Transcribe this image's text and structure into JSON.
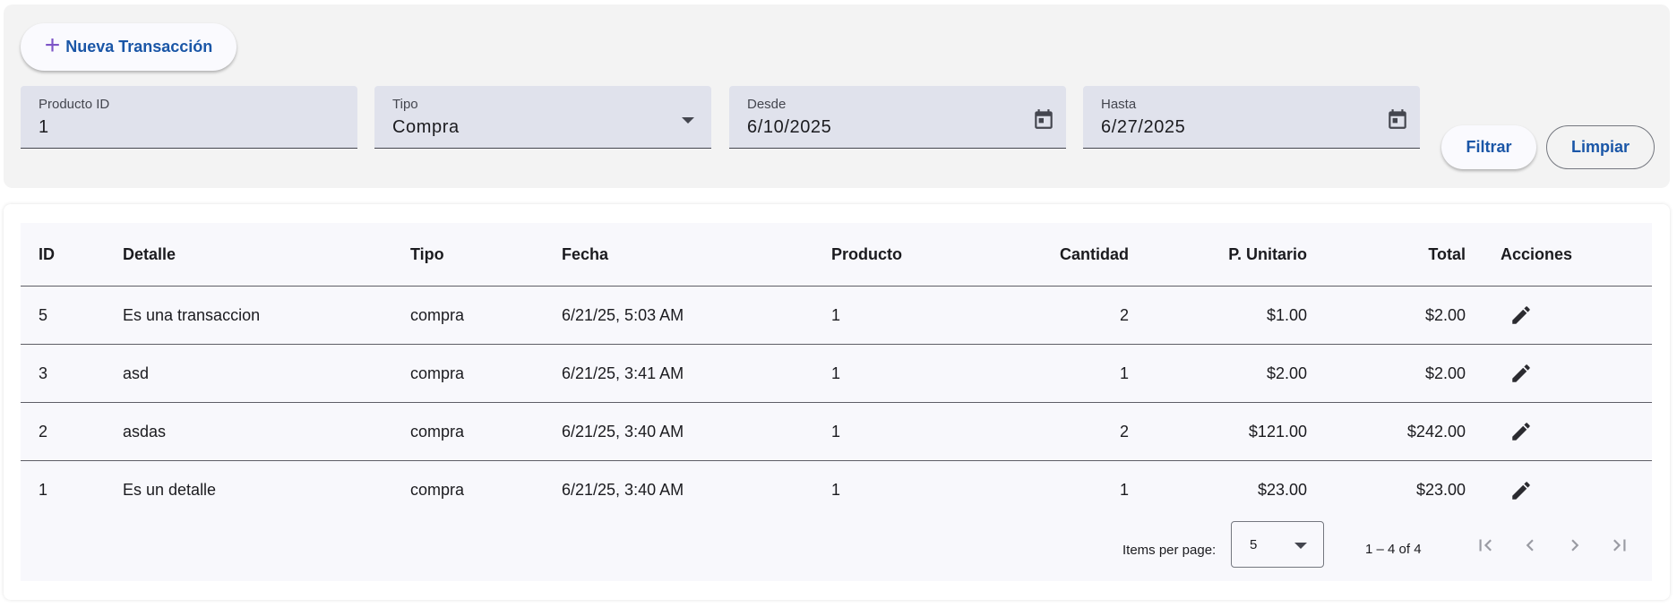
{
  "toolbar": {
    "new_label": "Nueva Transacción"
  },
  "filters": {
    "producto": {
      "label": "Producto ID",
      "value": "1"
    },
    "tipo": {
      "label": "Tipo",
      "value": "Compra"
    },
    "desde": {
      "label": "Desde",
      "value": "6/10/2025"
    },
    "hasta": {
      "label": "Hasta",
      "value": "6/27/2025"
    },
    "filtrar_label": "Filtrar",
    "limpiar_label": "Limpiar"
  },
  "table": {
    "headers": {
      "id": "ID",
      "detalle": "Detalle",
      "tipo": "Tipo",
      "fecha": "Fecha",
      "producto": "Producto",
      "cantidad": "Cantidad",
      "unitario": "P. Unitario",
      "total": "Total",
      "acciones": "Acciones"
    },
    "rows": [
      {
        "id": "5",
        "detalle": "Es una transaccion",
        "tipo": "compra",
        "fecha": "6/21/25, 5:03 AM",
        "producto": "1",
        "cantidad": "2",
        "unitario": "$1.00",
        "total": "$2.00"
      },
      {
        "id": "3",
        "detalle": "asd",
        "tipo": "compra",
        "fecha": "6/21/25, 3:41 AM",
        "producto": "1",
        "cantidad": "1",
        "unitario": "$2.00",
        "total": "$2.00"
      },
      {
        "id": "2",
        "detalle": "asdas",
        "tipo": "compra",
        "fecha": "6/21/25, 3:40 AM",
        "producto": "1",
        "cantidad": "2",
        "unitario": "$121.00",
        "total": "$242.00"
      },
      {
        "id": "1",
        "detalle": "Es un detalle",
        "tipo": "compra",
        "fecha": "6/21/25, 3:40 AM",
        "producto": "1",
        "cantidad": "1",
        "unitario": "$23.00",
        "total": "$23.00"
      }
    ]
  },
  "paginator": {
    "items_per_page_label": "Items per page:",
    "page_size": "5",
    "range_label": "1 – 4 of 4"
  },
  "icons": {
    "add": "plus-icon",
    "calendar": "calendar-icon",
    "edit": "pencil-icon",
    "first": "first-page-icon",
    "prev": "chevron-left-icon",
    "next": "chevron-right-icon",
    "last": "last-page-icon"
  },
  "colors": {
    "accent": "#1a56a7",
    "plus": "#7d55c7",
    "field_bg": "#e0e2ec",
    "panel_bg": "#f3f3f3"
  }
}
